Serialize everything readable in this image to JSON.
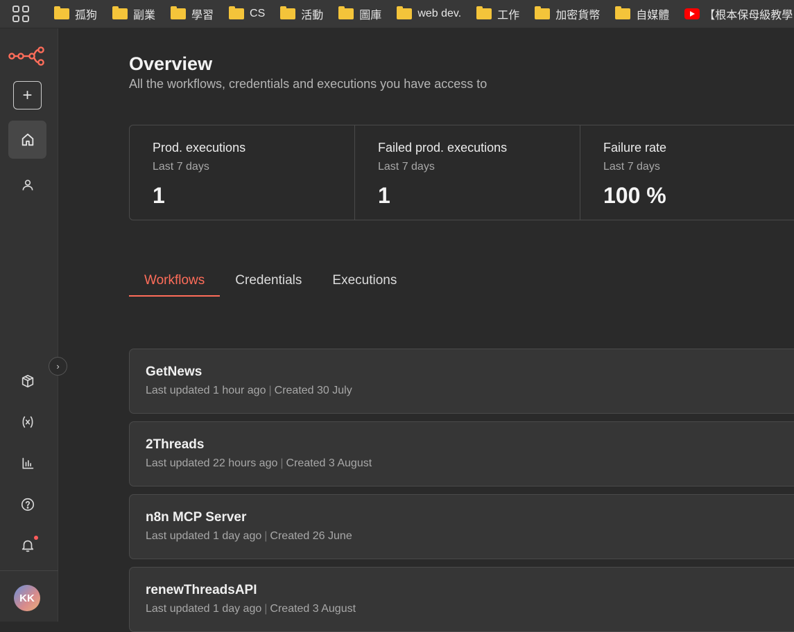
{
  "bookmarks": [
    {
      "label": "孤狗",
      "icon": "folder-icon"
    },
    {
      "label": "副業",
      "icon": "folder-icon"
    },
    {
      "label": "學習",
      "icon": "folder-icon"
    },
    {
      "label": "CS",
      "icon": "folder-icon"
    },
    {
      "label": "活動",
      "icon": "folder-icon"
    },
    {
      "label": "圖庫",
      "icon": "folder-icon"
    },
    {
      "label": "web dev.",
      "icon": "folder-icon"
    },
    {
      "label": "工作",
      "icon": "folder-icon"
    },
    {
      "label": "加密貨幣",
      "icon": "folder-icon"
    },
    {
      "label": "自媒體",
      "icon": "folder-icon"
    },
    {
      "label": "【根本保母級教學",
      "icon": "youtube-icon"
    }
  ],
  "sidebar": {
    "new_label": "+",
    "avatar_initials": "KK",
    "collapse_label": "›"
  },
  "header": {
    "title": "Overview",
    "subtitle": "All the workflows, credentials and executions you have access to"
  },
  "stats": [
    {
      "label": "Prod. executions",
      "period": "Last 7 days",
      "value": "1"
    },
    {
      "label": "Failed prod. executions",
      "period": "Last 7 days",
      "value": "1"
    },
    {
      "label": "Failure rate",
      "period": "Last 7 days",
      "value": "100 %"
    }
  ],
  "tabs": [
    {
      "label": "Workflows",
      "active": true
    },
    {
      "label": "Credentials",
      "active": false
    },
    {
      "label": "Executions",
      "active": false
    }
  ],
  "workflows": [
    {
      "name": "GetNews",
      "updated": "Last updated 1 hour ago",
      "created": "Created 30 July"
    },
    {
      "name": "2Threads",
      "updated": "Last updated 22 hours ago",
      "created": "Created 3 August"
    },
    {
      "name": "n8n MCP Server",
      "updated": "Last updated 1 day ago",
      "created": "Created 26 June"
    },
    {
      "name": "renewThreadsAPI",
      "updated": "Last updated 1 day ago",
      "created": "Created 3 August"
    }
  ],
  "colors": {
    "accent": "#ff6d5a",
    "background": "#2a2a2a",
    "sidebar": "#333333",
    "card": "#363636"
  }
}
